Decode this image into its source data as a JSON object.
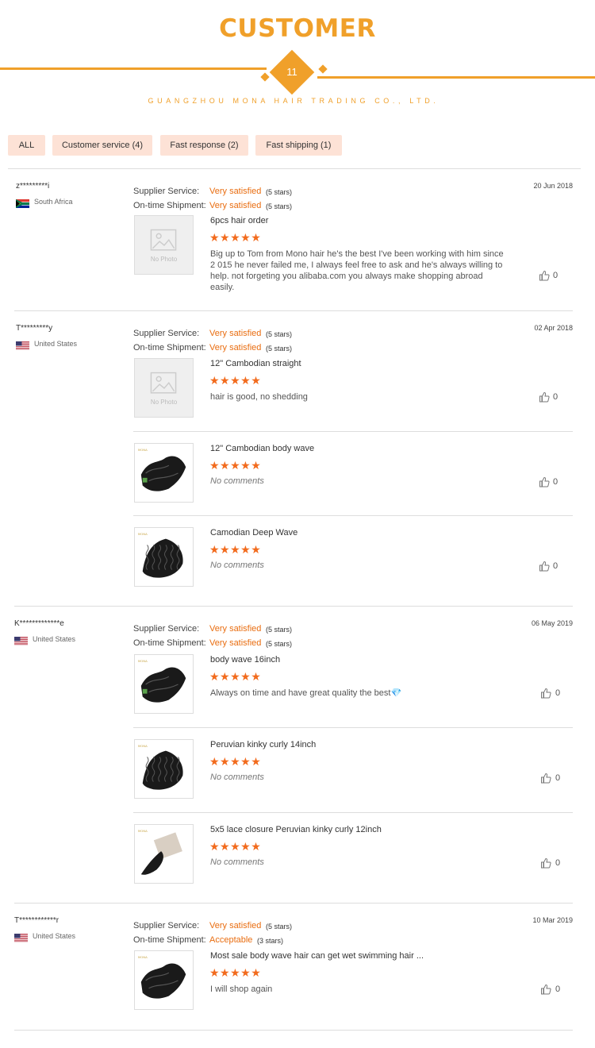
{
  "header": {
    "title": "CUSTOMER",
    "number": "11",
    "company": "GUANGZHOU MONA HAIR TRADING CO., LTD."
  },
  "filters": [
    {
      "label": "ALL"
    },
    {
      "label": "Customer service (4)"
    },
    {
      "label": "Fast response (2)"
    },
    {
      "label": "Fast shipping (1)"
    }
  ],
  "labels": {
    "supplier": "Supplier Service:",
    "shipment": "On-time Shipment:",
    "no_photo": "No Photo"
  },
  "colors": {
    "accent": "#f0a02a",
    "rating": "#f26b1d",
    "filter_bg": "#fde2d6"
  },
  "reviews": [
    {
      "user": "z*********i",
      "country": "South Africa",
      "flag": "south-africa-flag",
      "date": "20 Jun 2018",
      "supplier": {
        "value": "Very satisfied",
        "stars": "(5 stars)"
      },
      "shipment": {
        "value": "Very satisfied",
        "stars": "(5 stars)"
      },
      "items": [
        {
          "title": "6pcs hair order",
          "rating": "★★★★★",
          "comment": "Big up to Tom from Mono hair he's the best I've been working with him since 2 015 he never failed me, I always feel free to ask and he's always willing to help. not forgeting you alibaba.com you always make shopping abroad easily.",
          "likes": "0"
        }
      ]
    },
    {
      "user": "T*********y",
      "country": "United States",
      "flag": "us-flag",
      "date": "02 Apr 2018",
      "supplier": {
        "value": "Very satisfied",
        "stars": "(5 stars)"
      },
      "shipment": {
        "value": "Very satisfied",
        "stars": "(5 stars)"
      },
      "items": [
        {
          "title": "12\" Cambodian straight",
          "rating": "★★★★★",
          "comment": "hair is good, no shedding",
          "likes": "0"
        },
        {
          "title": "12\" Cambodian body wave",
          "rating": "★★★★★",
          "comment": "No comments",
          "likes": "0"
        },
        {
          "title": "Camodian Deep Wave",
          "rating": "★★★★★",
          "comment": "No comments",
          "likes": "0"
        }
      ]
    },
    {
      "user": "K*************e",
      "country": "United States",
      "flag": "us-flag",
      "date": "06 May 2019",
      "supplier": {
        "value": "Very satisfied",
        "stars": "(5 stars)"
      },
      "shipment": {
        "value": "Very satisfied",
        "stars": "(5 stars)"
      },
      "items": [
        {
          "title": "body wave 16inch",
          "rating": "★★★★★",
          "comment": "Always on time and have great quality the best💎",
          "likes": "0"
        },
        {
          "title": "Peruvian kinky curly 14inch",
          "rating": "★★★★★",
          "comment": "No comments",
          "likes": "0"
        },
        {
          "title": "5x5 lace closure Peruvian kinky curly 12inch",
          "rating": "★★★★★",
          "comment": "No comments",
          "likes": "0"
        }
      ]
    },
    {
      "user": "T************r",
      "country": "United States",
      "flag": "us-flag",
      "date": "10 Mar 2019",
      "supplier": {
        "value": "Very satisfied",
        "stars": "(5 stars)"
      },
      "shipment": {
        "value": "Acceptable",
        "stars": "(3 stars)"
      },
      "items": [
        {
          "title": "Most sale body wave hair can get wet swimming hair ...",
          "rating": "★★★★★",
          "comment": "I will shop again",
          "likes": "0"
        }
      ]
    }
  ]
}
